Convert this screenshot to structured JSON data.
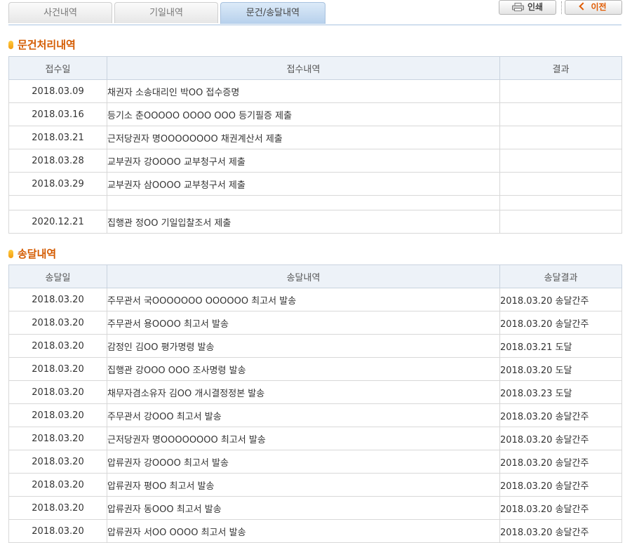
{
  "tabs": [
    {
      "label": "사건내역",
      "active": false
    },
    {
      "label": "기일내역",
      "active": false
    },
    {
      "label": "문건/송달내역",
      "active": true
    }
  ],
  "toolbar": {
    "print_label": "인쇄",
    "prev_label": "이전",
    "print_icon": "printer-icon",
    "prev_icon": "chevron-left-icon"
  },
  "colors": {
    "accent": "#d45b00",
    "header_bg": "#edf2f8",
    "active_tab": "#b6d0ec"
  },
  "documents": {
    "title": "문건처리내역",
    "columns": [
      "접수일",
      "접수내역",
      "결과"
    ],
    "rows": [
      {
        "date": "2018.03.09",
        "detail": "채권자 소송대리인 박OO 접수증명",
        "result": ""
      },
      {
        "date": "2018.03.16",
        "detail": "등기소 춘OOOOO OOOO OOO 등기필증 제출",
        "result": ""
      },
      {
        "date": "2018.03.21",
        "detail": "근저당권자 명OOOOOOOO 채권계산서 제출",
        "result": ""
      },
      {
        "date": "2018.03.28",
        "detail": "교부권자 강OOOO 교부청구서 제출",
        "result": ""
      },
      {
        "date": "2018.03.29",
        "detail": "교부권자 삼OOOO 교부청구서 제출",
        "result": ""
      },
      {
        "date": "2020.12.21",
        "detail": "집행관 정OO 기일입찰조서 제출",
        "result": ""
      }
    ]
  },
  "deliveries": {
    "title": "송달내역",
    "columns": [
      "송달일",
      "송달내역",
      "송달결과"
    ],
    "rows": [
      {
        "date": "2018.03.20",
        "detail": "주무관서 국OOOOOOO OOOOOO 최고서 발송",
        "result": "2018.03.20 송달간주"
      },
      {
        "date": "2018.03.20",
        "detail": "주무관서 용OOOO 최고서 발송",
        "result": "2018.03.20 송달간주"
      },
      {
        "date": "2018.03.20",
        "detail": "감정인 김OO 평가명령 발송",
        "result": "2018.03.21 도달"
      },
      {
        "date": "2018.03.20",
        "detail": "집행관 강OOO OOO 조사명령 발송",
        "result": "2018.03.20 도달"
      },
      {
        "date": "2018.03.20",
        "detail": "채무자겸소유자 김OO 개시결정정본 발송",
        "result": "2018.03.23 도달"
      },
      {
        "date": "2018.03.20",
        "detail": "주무관서 강OOO 최고서 발송",
        "result": "2018.03.20 송달간주"
      },
      {
        "date": "2018.03.20",
        "detail": "근저당권자 명OOOOOOOO 최고서 발송",
        "result": "2018.03.20 송달간주"
      },
      {
        "date": "2018.03.20",
        "detail": "압류권자 강OOOO 최고서 발송",
        "result": "2018.03.20 송달간주"
      },
      {
        "date": "2018.03.20",
        "detail": "압류권자 평OO 최고서 발송",
        "result": "2018.03.20 송달간주"
      },
      {
        "date": "2018.03.20",
        "detail": "압류권자 동OOO 최고서 발송",
        "result": "2018.03.20 송달간주"
      },
      {
        "date": "2018.03.20",
        "detail": "압류권자 서OO OOOO 최고서 발송",
        "result": "2018.03.20 송달간주"
      }
    ]
  }
}
